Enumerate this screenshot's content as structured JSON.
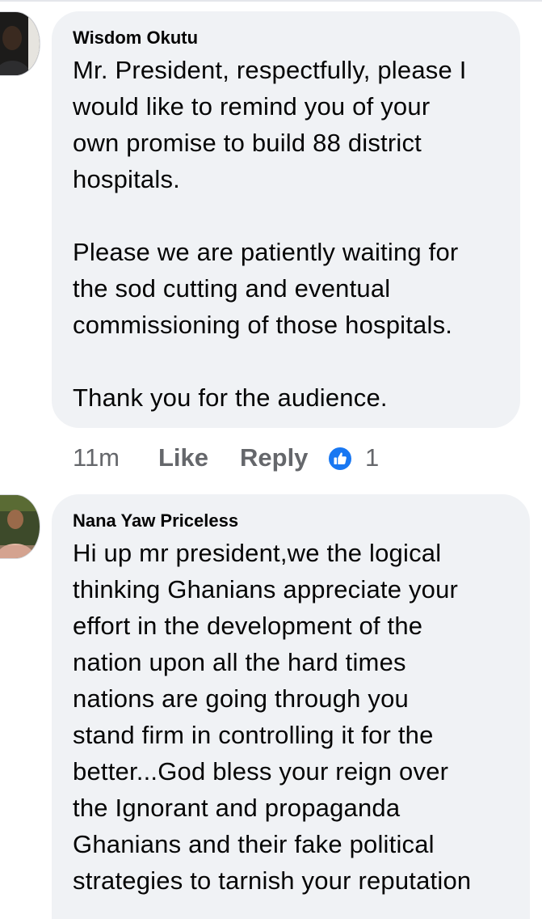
{
  "comments": [
    {
      "author": "Wisdom Okutu",
      "text": "Mr. President, respectfully, please I\nwould like to remind you of your\nown promise to build 88 district\nhospitals.\n\nPlease we are patiently waiting for\nthe sod cutting and eventual\ncommissioning of those hospitals.\n\nThank you for the audience.",
      "time": "11m",
      "like_label": "Like",
      "reply_label": "Reply",
      "reaction_icon": "thumbs-up-icon",
      "reaction_count": "1"
    },
    {
      "author": "Nana Yaw Priceless",
      "text": "Hi up mr president,we the logical\nthinking Ghanians appreciate your\neffort in the development of the\nnation upon all the hard times\nnations are going through you\nstand firm in controlling it for the\nbetter...God bless your reign over\nthe Ignorant and propaganda\nGhanians and their fake political\nstrategies to tarnish your reputation"
    }
  ],
  "colors": {
    "bubble": "#f0f2f5",
    "text": "#050505",
    "secondary_text": "#65676b",
    "like_accent": "#1877f2"
  }
}
